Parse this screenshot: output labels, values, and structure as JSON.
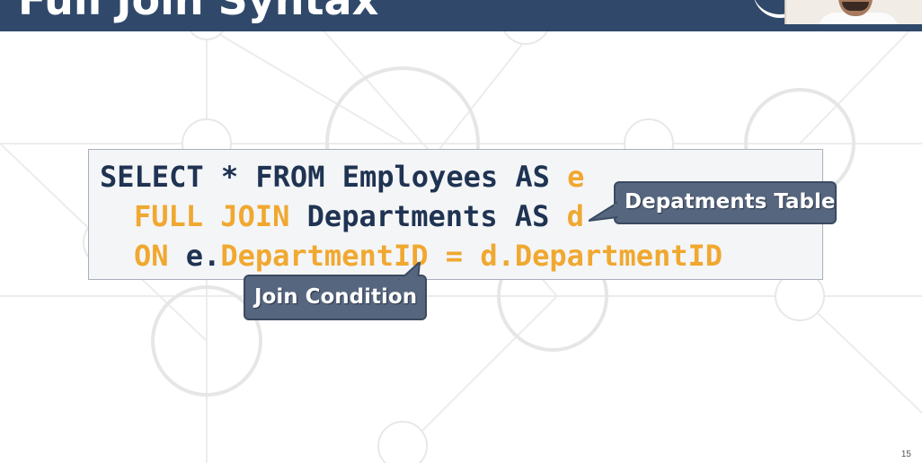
{
  "slide": {
    "title": "Full Join Syntax",
    "page_number": "15"
  },
  "code": {
    "line1": {
      "k1": "SELECT * FROM Employees AS ",
      "alias": "e"
    },
    "line2": {
      "k1": "FULL",
      "k2": " ",
      "k3": "JOIN",
      "k4": " Departments AS ",
      "alias": "d"
    },
    "line3": {
      "k1": "ON",
      "k2": " e.",
      "k3": "DepartmentID",
      "k4": " = ",
      "k5": "d.DepartmentID"
    }
  },
  "callouts": {
    "departments": "Depatments Table",
    "join_condition": "Join Condition"
  },
  "colors": {
    "header": "#30496a",
    "code_text": "#1f3352",
    "code_highlight": "#f0a830",
    "callout_bg": "#56667f"
  }
}
